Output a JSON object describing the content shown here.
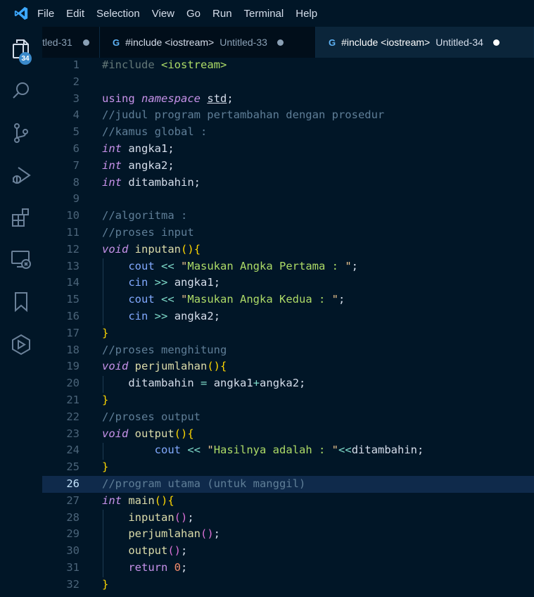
{
  "menu": [
    "File",
    "Edit",
    "Selection",
    "View",
    "Go",
    "Run",
    "Terminal",
    "Help"
  ],
  "activity_bar": {
    "badge": "34",
    "icons": [
      "explorer-icon",
      "search-icon",
      "source-control-icon",
      "run-debug-icon",
      "extensions-icon",
      "remote-explorer-icon",
      "bookmarks-icon",
      "package-icon"
    ]
  },
  "tabs": [
    {
      "name": "",
      "desc": "tled-31"
    },
    {
      "name": "#include <iostream>",
      "desc": "Untitled-33"
    },
    {
      "name": "#include <iostream>",
      "desc": "Untitled-34"
    }
  ],
  "editor": {
    "current_line": 26,
    "lines": [
      "#include <iostream>",
      "",
      "using namespace std;",
      "//judul program pertambahan dengan prosedur",
      "//kamus global :",
      "int angka1;",
      "int angka2;",
      "int ditambahin;",
      "",
      "//algoritma :",
      "//proses input",
      "void inputan(){",
      "    cout << \"Masukan Angka Pertama : \";",
      "    cin >> angka1;",
      "    cout << \"Masukan Angka Kedua : \";",
      "    cin >> angka2;",
      "}",
      "//proses menghitung",
      "void perjumlahan(){",
      "    ditambahin = angka1+angka2;",
      "}",
      "//proses output",
      "void output(){",
      "        cout << \"Hasilnya adalah : \"<<ditambahin;",
      "}",
      "//program utama (untuk manggil)",
      "int main(){",
      "    inputan();",
      "    perjumlahan();",
      "    output();",
      "    return 0;",
      "}"
    ]
  },
  "colors": {
    "background": "#011627",
    "tab_bar": "#010e1a",
    "active_tab": "#0b253a",
    "current_line": "#0f2a4b",
    "badge": "#3a89c9"
  }
}
